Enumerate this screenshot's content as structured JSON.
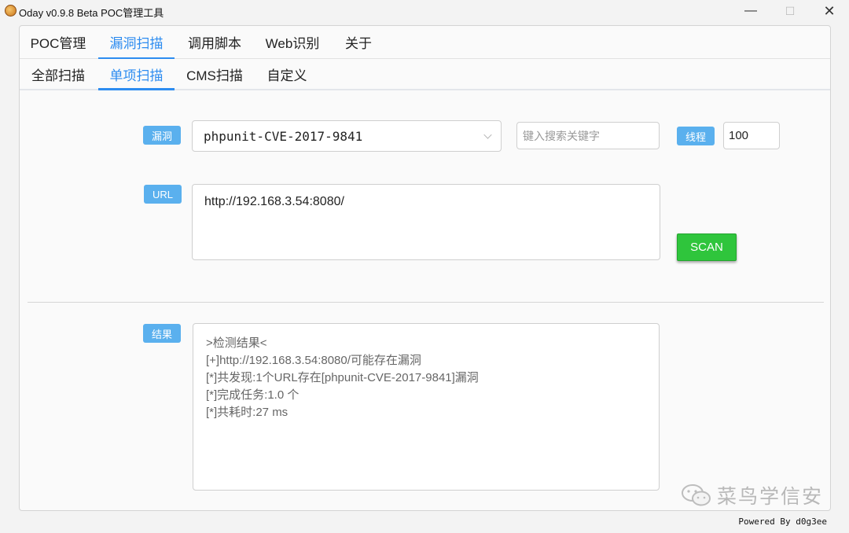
{
  "window": {
    "title": "Oday v0.9.8 Beta POC管理工具",
    "min_glyph": "—",
    "max_glyph": "☐",
    "close_glyph": "✕"
  },
  "main_tabs": [
    {
      "label": "POC管理",
      "active": false
    },
    {
      "label": "漏洞扫描",
      "active": true
    },
    {
      "label": "调用脚本",
      "active": false
    },
    {
      "label": "Web识别",
      "active": false
    },
    {
      "label": "关于",
      "active": false
    }
  ],
  "sub_tabs": [
    {
      "label": "全部扫描",
      "active": false
    },
    {
      "label": "单项扫描",
      "active": true
    },
    {
      "label": "CMS扫描",
      "active": false
    },
    {
      "label": "自定义",
      "active": false
    }
  ],
  "form": {
    "vuln_label": "漏洞",
    "vuln_selected": "phpunit-CVE-2017-9841",
    "search_placeholder": "键入搜索关键字",
    "thread_label": "线程",
    "thread_value": "100",
    "url_label": "URL",
    "url_value": "http://192.168.3.54:8080/",
    "scan_label": "SCAN"
  },
  "result": {
    "label": "结果",
    "lines": [
      ">检测结果<",
      "[+]http://192.168.3.54:8080/可能存在漏洞",
      "[*]共发现:1个URL存在[phpunit-CVE-2017-9841]漏洞",
      "[*]完成任务:1.0 个",
      "[*]共耗时:27 ms"
    ]
  },
  "watermark": "菜鸟学信安",
  "footer": "Powered By d0g3ee",
  "colors": {
    "accent": "#2d8cf0",
    "tag": "#5ab0ee",
    "scan": "#2fc53c"
  }
}
